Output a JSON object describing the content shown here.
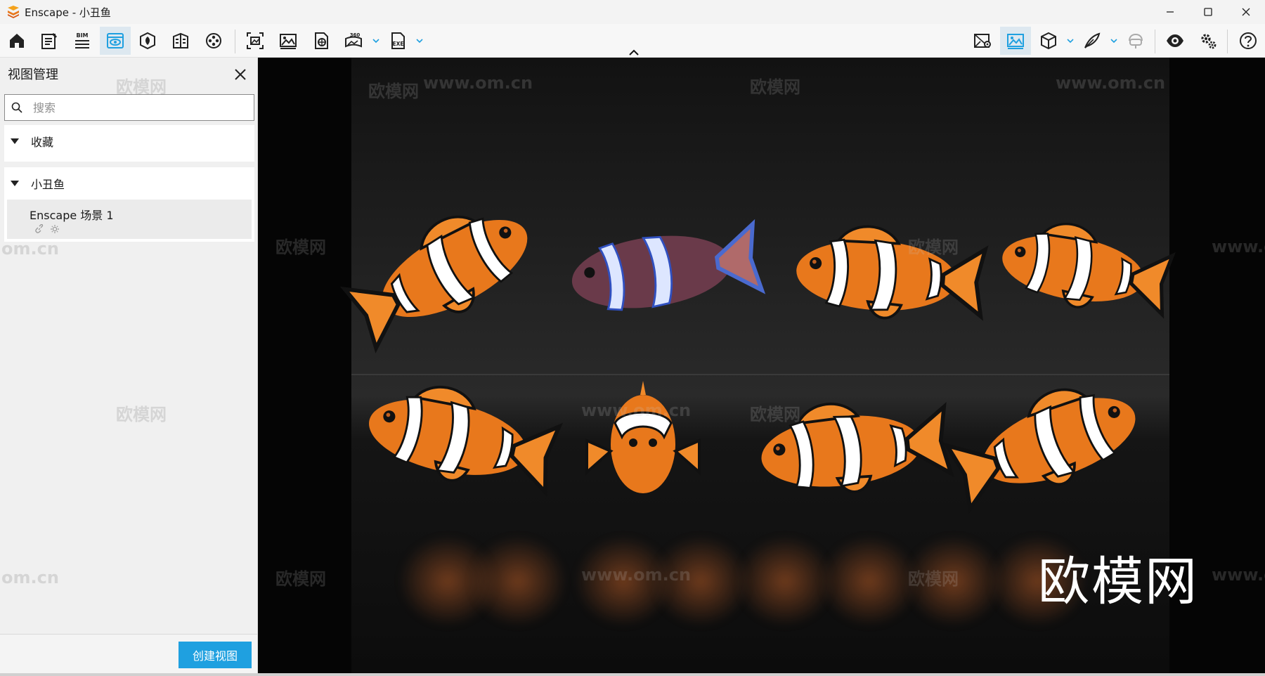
{
  "window": {
    "title": "Enscape - 小丑鱼",
    "minimize_label": "minimize",
    "maximize_label": "maximize",
    "close_label": "close"
  },
  "toolbar": {
    "bim_label": "BIM",
    "pano_label": "360",
    "exe_label": "EXE"
  },
  "panel": {
    "title": "视图管理",
    "search_placeholder": "搜索",
    "groups": [
      {
        "label": "收藏"
      },
      {
        "label": "小丑鱼",
        "views": [
          {
            "name": "Enscape 场景 1"
          }
        ]
      }
    ],
    "create_button": "创建视图"
  },
  "viewport": {
    "watermark": "欧模网",
    "watermark_url": "www.om.cn",
    "watermark_url_short": "om.cn"
  },
  "colors": {
    "accent": "#1fa0e0",
    "active_tool_bg": "#dde8f0",
    "clownfish_orange": "#e8781c"
  }
}
